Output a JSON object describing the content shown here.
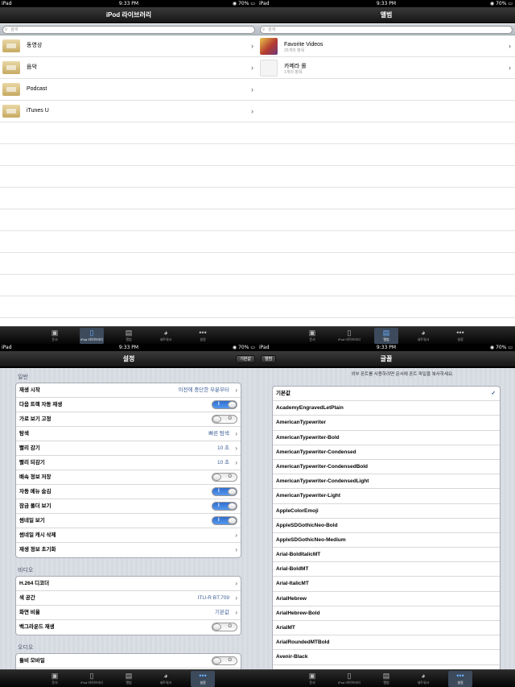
{
  "status": {
    "carrier": "iPad",
    "time": "9:33 PM",
    "battery": "70%"
  },
  "q1": {
    "title": "iPod 라이브러리",
    "search_placeholder": "검색",
    "items": [
      {
        "label": "동영상"
      },
      {
        "label": "음악"
      },
      {
        "label": "Podcast"
      },
      {
        "label": "iTunes U"
      }
    ]
  },
  "q2": {
    "title": "앨범",
    "search_placeholder": "검색",
    "items": [
      {
        "label": "Favorite Videos",
        "sub": "25개의 항목"
      },
      {
        "label": "카메라 롤",
        "sub": "1개의 항목"
      }
    ]
  },
  "tabs": [
    {
      "label": "문서",
      "icon": "document-icon"
    },
    {
      "label": "iPod 라이브러리",
      "icon": "ipod-icon"
    },
    {
      "label": "앨범",
      "icon": "album-icon"
    },
    {
      "label": "네트워크",
      "icon": "network-icon"
    },
    {
      "label": "설정",
      "icon": "more-icon"
    }
  ],
  "q3": {
    "title": "설정",
    "btn_default": "기본값",
    "btn_album": "앨범",
    "sections": [
      {
        "header": "일반",
        "rows": [
          {
            "label": "재생 시작",
            "value": "이전에 중단한 부분부터",
            "type": "nav"
          },
          {
            "label": "다음 트랙 자동 재생",
            "type": "switch",
            "on": true
          },
          {
            "label": "가로 보기 고정",
            "type": "switch",
            "on": false
          },
          {
            "label": "탐색",
            "value": "빠른 탐색",
            "type": "nav"
          },
          {
            "label": "빨리 감기",
            "value": "10 초",
            "type": "nav"
          },
          {
            "label": "빨리 되감기",
            "value": "10 초",
            "type": "nav"
          },
          {
            "label": "배속 정보 저장",
            "type": "switch",
            "on": false
          },
          {
            "label": "자동 메뉴 숨김",
            "type": "switch",
            "on": true
          },
          {
            "label": "잠금 폴더 보기",
            "type": "switch",
            "on": true
          },
          {
            "label": "썸네일 보기",
            "type": "switch",
            "on": true
          },
          {
            "label": "썸네일 캐시 삭제",
            "value": "",
            "type": "nav"
          },
          {
            "label": "재생 정보 초기화",
            "value": "",
            "type": "nav"
          }
        ]
      },
      {
        "header": "비디오",
        "rows": [
          {
            "label": "H.264 디코더",
            "value": "",
            "type": "nav"
          },
          {
            "label": "색 공간",
            "value": "ITU-R BT.709",
            "type": "nav"
          },
          {
            "label": "화면 비율",
            "value": "기본값",
            "type": "nav"
          },
          {
            "label": "백그라운드 재생",
            "type": "switch",
            "on": false
          }
        ]
      },
      {
        "header": "오디오",
        "rows": [
          {
            "label": "돌비 모바일",
            "type": "switch",
            "on": false
          },
          {
            "label": "",
            "type": "nav",
            "value": ""
          }
        ]
      }
    ],
    "switch_on": "I",
    "switch_off": "O"
  },
  "q4": {
    "title": "글꼴",
    "hint": "외부 폰트를 사용하려면 문서에 폰트 파일을 복사하세요.",
    "checkmark": "✓",
    "fonts": [
      "기본값",
      "AcademyEngravedLetPlain",
      "AmericanTypewriter",
      "AmericanTypewriter-Bold",
      "AmericanTypewriter-Condensed",
      "AmericanTypewriter-CondensedBold",
      "AmericanTypewriter-CondensedLight",
      "AmericanTypewriter-Light",
      "AppleColorEmoji",
      "AppleSDGothicNeo-Bold",
      "AppleSDGothicNeo-Medium",
      "Arial-BoldItalicMT",
      "Arial-BoldMT",
      "Arial-ItalicMT",
      "ArialHebrew",
      "ArialHebrew-Bold",
      "ArialMT",
      "ArialRoundedMTBold",
      "Avenir-Black"
    ]
  },
  "colors": {
    "accent": "#3b5e95",
    "switch_on": "#2f6ecf",
    "tab_selected": "#3c4a5c"
  }
}
